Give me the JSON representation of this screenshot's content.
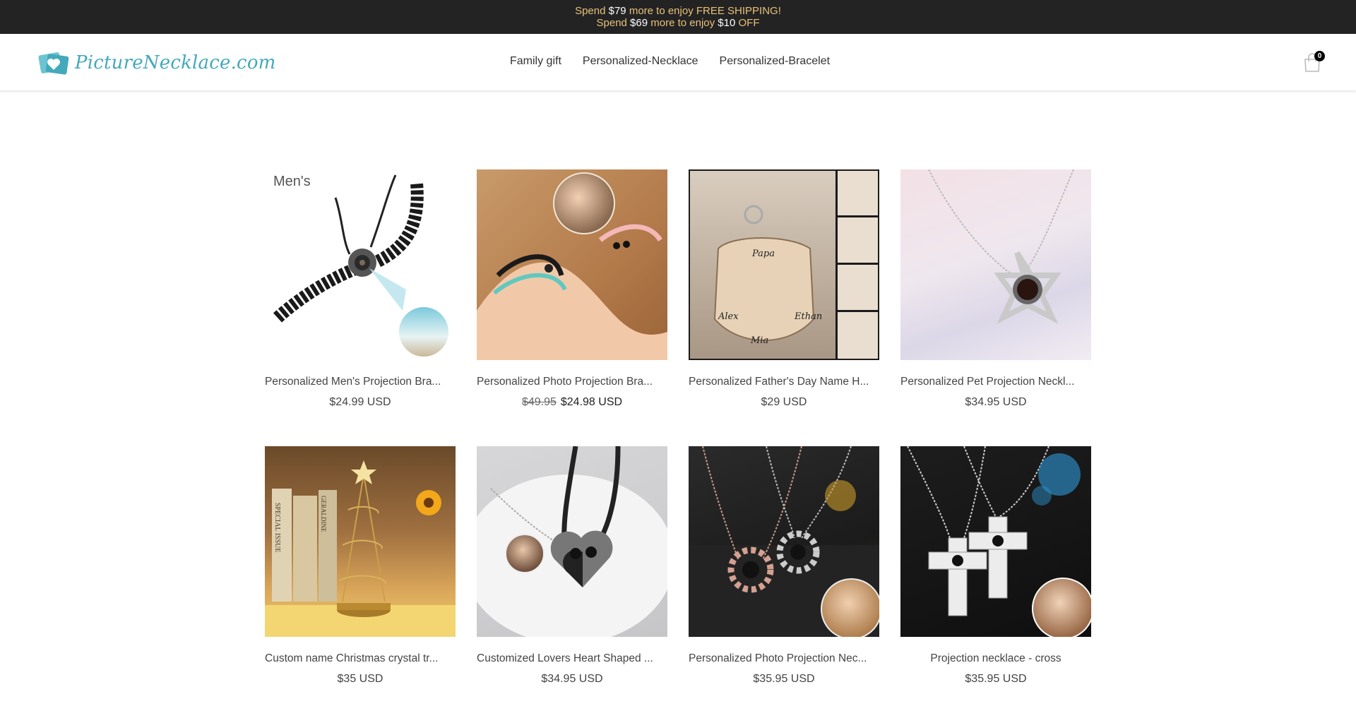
{
  "announcement": {
    "line1_pre": "Spend ",
    "line1_amount": "$79",
    "line1_post": " more to enjoy FREE SHIPPING!",
    "line2_pre": "Spend ",
    "line2_amount": "$69",
    "line2_mid": " more to enjoy ",
    "line2_discount": "$10",
    "line2_post": " OFF"
  },
  "header": {
    "logo_text": "PictureNecklace.com",
    "nav": [
      "Family gift",
      "Personalized-Necklace",
      "Personalized-Bracelet"
    ],
    "cart_count": "0"
  },
  "products": [
    {
      "title": "Personalized Men's Projection Bra...",
      "price": "$24.99 USD",
      "badge": "Men's"
    },
    {
      "title": "Personalized Photo Projection Bra...",
      "old_price": "$49.95",
      "price": "$24.98 USD"
    },
    {
      "title": "Personalized Father's Day Name H...",
      "price": "$29 USD",
      "keychain_text": "Papa",
      "names": [
        "Alex",
        "Mia",
        "Ethan"
      ]
    },
    {
      "title": "Personalized Pet Projection Neckl...",
      "price": "$34.95 USD"
    },
    {
      "title": "Custom name Christmas crystal tr...",
      "price": "$35 USD",
      "book1": "SPECIAL ISSUE",
      "book2": "GERALDINE"
    },
    {
      "title": "Customized Lovers Heart Shaped ...",
      "price": "$34.95 USD"
    },
    {
      "title": "Personalized Photo Projection Nec...",
      "price": "$35.95 USD"
    },
    {
      "title": "Projection necklace - cross",
      "price": "$35.95 USD"
    }
  ],
  "colors": {
    "announce_bg": "#232323",
    "announce_text": "#e8c17a",
    "logo": "#43a9bb"
  }
}
